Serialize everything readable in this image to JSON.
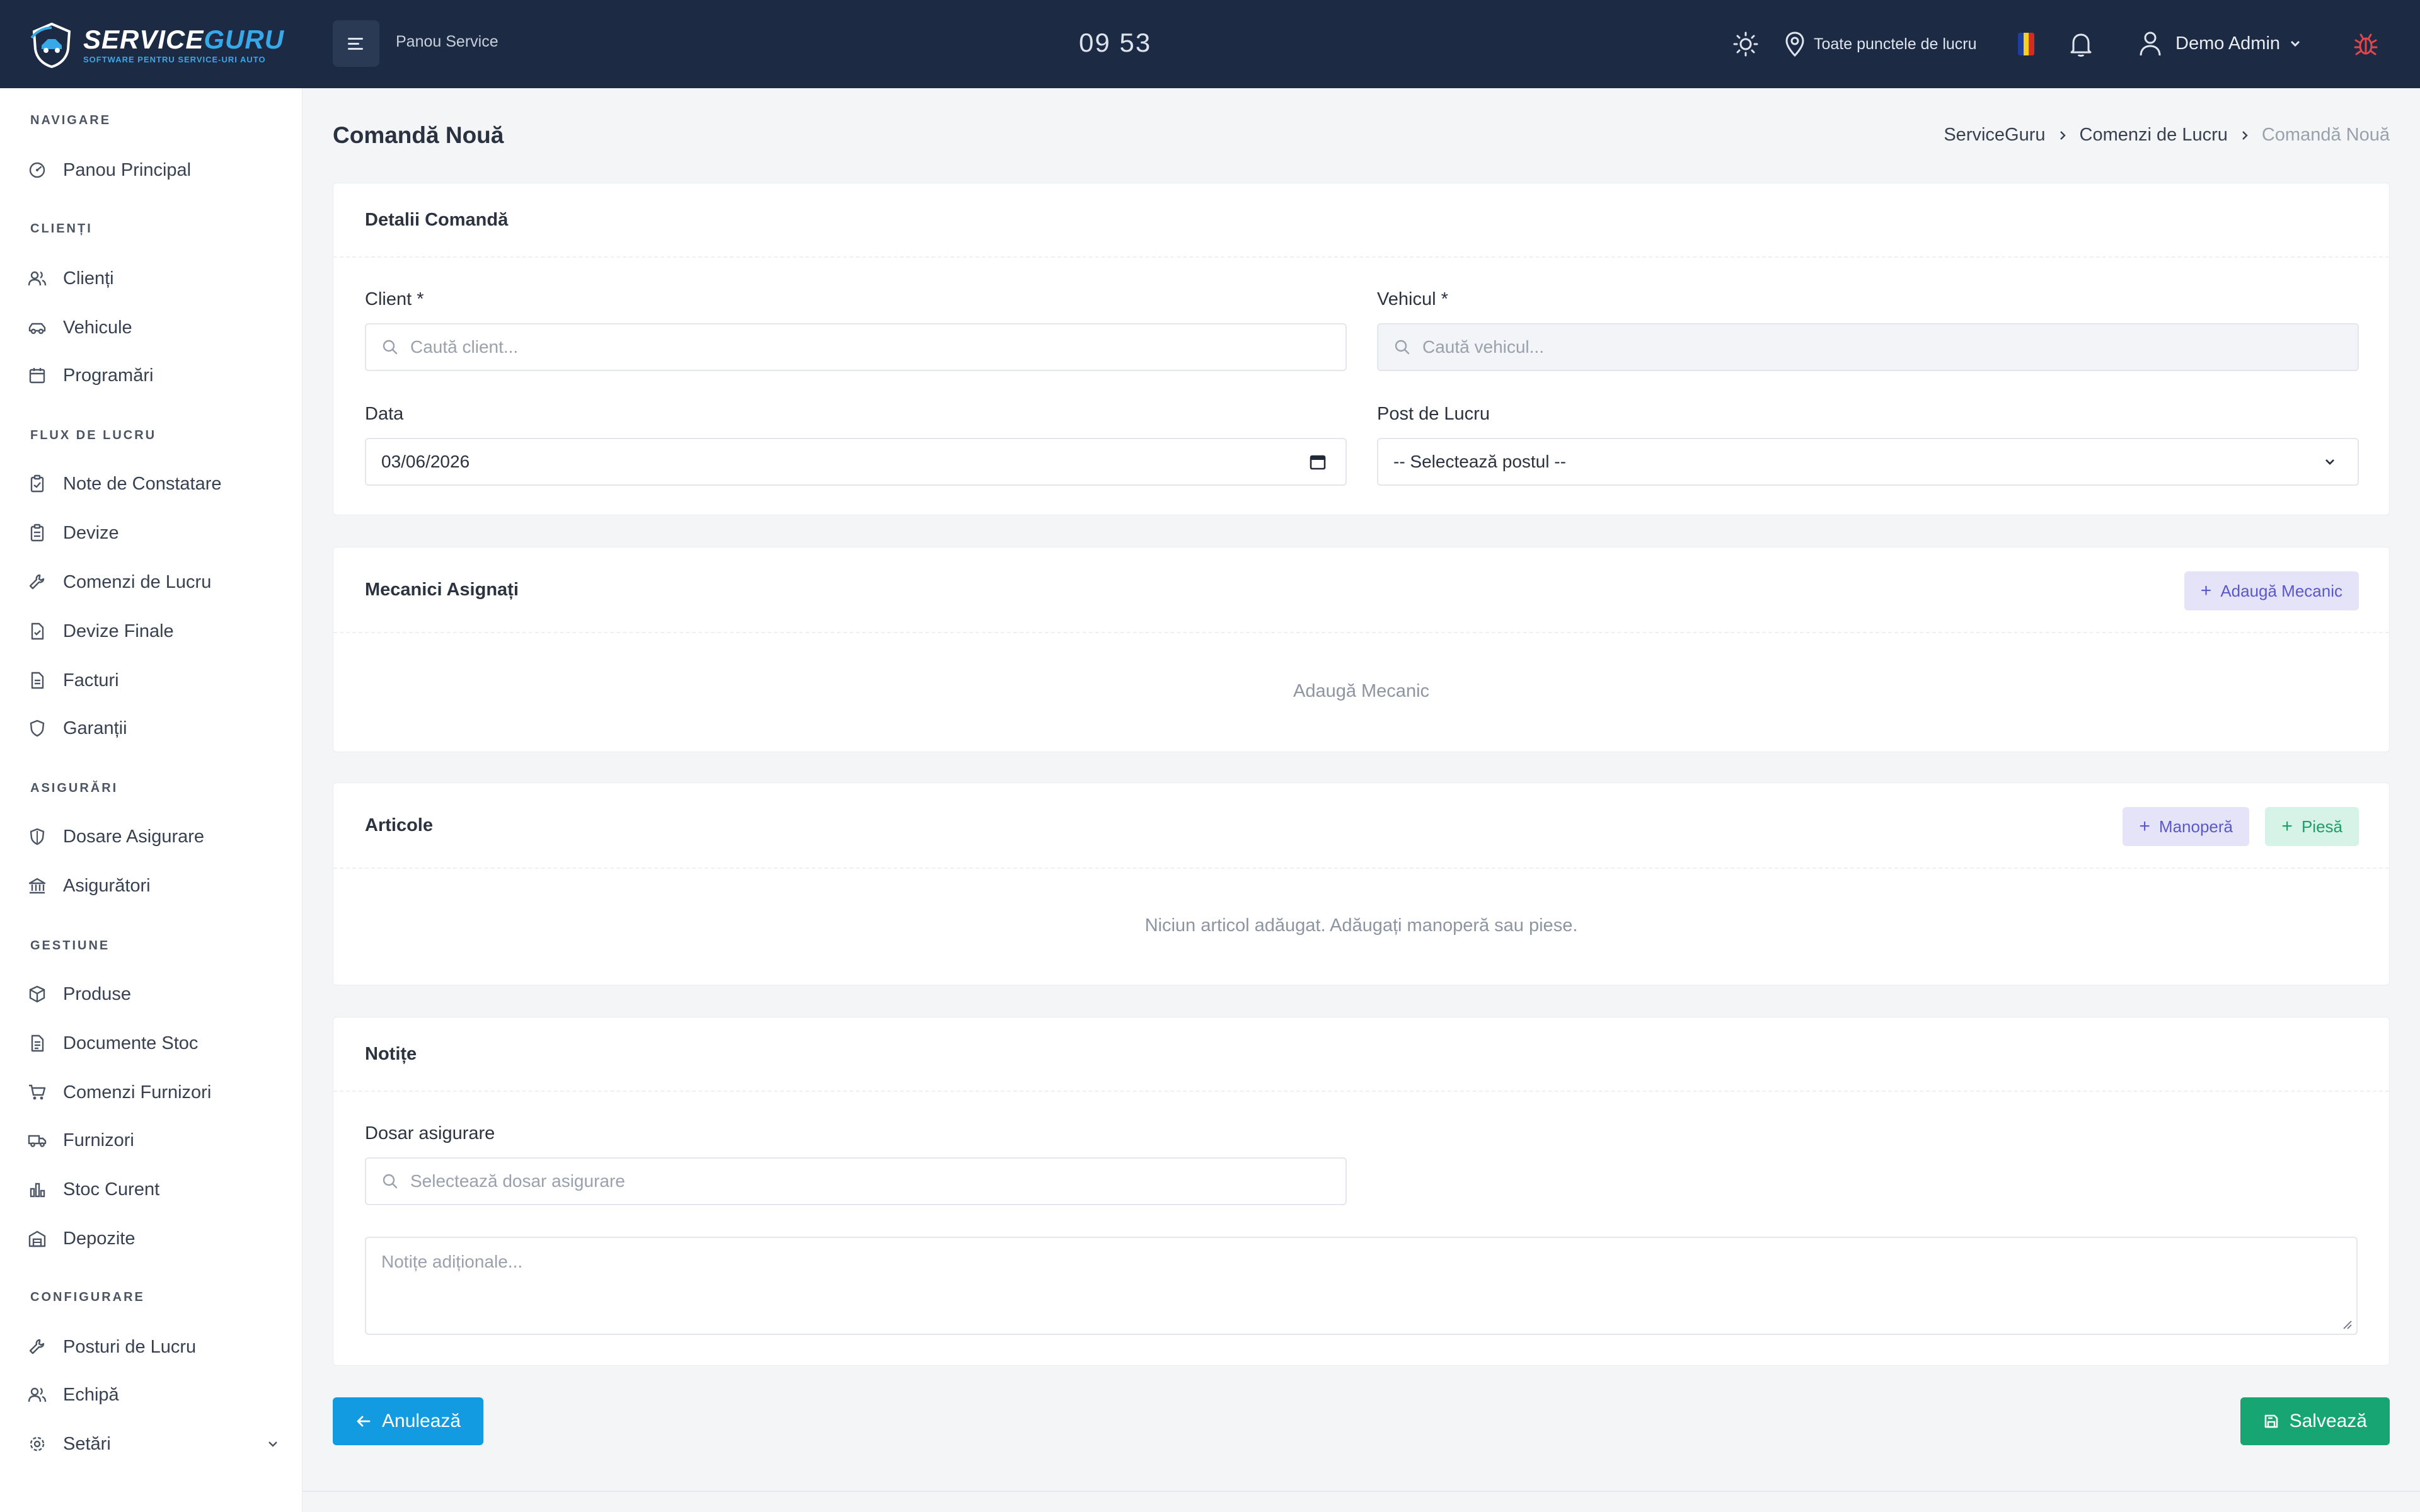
{
  "topbar": {
    "brand_white": "SERVICE",
    "brand_blue": "GURU",
    "brand_tagline": "SOFTWARE PENTRU SERVICE-URI AUTO",
    "panel_label": "Panou Service",
    "clock": "09 53",
    "location_label": "Toate punctele de lucru",
    "user_name": "Demo Admin",
    "colors": {
      "bg": "#1c2a44",
      "accent": "#38a8e8",
      "bug": "#e0474c"
    }
  },
  "sidebar": {
    "sections": [
      {
        "title": "NAVIGARE",
        "items": [
          {
            "label": "Panou Principal",
            "icon": "dashboard-icon"
          }
        ]
      },
      {
        "title": "CLIENȚI",
        "items": [
          {
            "label": "Clienți",
            "icon": "users-icon"
          },
          {
            "label": "Vehicule",
            "icon": "car-icon"
          },
          {
            "label": "Programări",
            "icon": "calendar-icon"
          }
        ]
      },
      {
        "title": "FLUX DE LUCRU",
        "items": [
          {
            "label": "Note de Constatare",
            "icon": "clipboard-icon"
          },
          {
            "label": "Devize",
            "icon": "clipboard-list-icon"
          },
          {
            "label": "Comenzi de Lucru",
            "icon": "wrench-icon"
          },
          {
            "label": "Devize Finale",
            "icon": "file-check-icon"
          },
          {
            "label": "Facturi",
            "icon": "file-text-icon"
          },
          {
            "label": "Garanții",
            "icon": "shield-check-icon"
          }
        ]
      },
      {
        "title": "ASIGURĂRI",
        "items": [
          {
            "label": "Dosare Asigurare",
            "icon": "shield-icon"
          },
          {
            "label": "Asigurători",
            "icon": "building-icon"
          }
        ]
      },
      {
        "title": "GESTIUNE",
        "items": [
          {
            "label": "Produse",
            "icon": "box-icon"
          },
          {
            "label": "Documente Stoc",
            "icon": "document-icon"
          },
          {
            "label": "Comenzi Furnizori",
            "icon": "cart-icon"
          },
          {
            "label": "Furnizori",
            "icon": "truck-icon"
          },
          {
            "label": "Stoc Curent",
            "icon": "bar-chart-icon"
          },
          {
            "label": "Depozite",
            "icon": "warehouse-icon"
          }
        ]
      },
      {
        "title": "CONFIGURARE",
        "items": [
          {
            "label": "Posturi de Lucru",
            "icon": "wrench-icon"
          },
          {
            "label": "Echipă",
            "icon": "team-icon"
          },
          {
            "label": "Setări",
            "icon": "gear-icon"
          }
        ]
      }
    ]
  },
  "page": {
    "title": "Comandă Nouă",
    "breadcrumb": [
      "ServiceGuru",
      "Comenzi de Lucru",
      "Comandă Nouă"
    ]
  },
  "order_details": {
    "title": "Detalii Comandă",
    "client_label": "Client *",
    "client_placeholder": "Caută client...",
    "vehicle_label": "Vehicul *",
    "vehicle_placeholder": "Caută vehicul...",
    "date_label": "Data",
    "date_value": "03/06/2026",
    "workstation_label": "Post de Lucru",
    "workstation_value": "-- Selectează postul --"
  },
  "mechanics": {
    "title": "Mecanici Asignați",
    "add_button": "Adaugă Mecanic",
    "empty": "Adaugă Mecanic"
  },
  "articles": {
    "title": "Articole",
    "labor_button": "Manoperă",
    "part_button": "Piesă",
    "empty": "Niciun articol adăugat. Adăugați manoperă sau piese."
  },
  "notes": {
    "title": "Notițe",
    "insurance_label": "Dosar asigurare",
    "insurance_placeholder": "Selectează dosar asigurare",
    "notes_placeholder": "Notițe adiționale..."
  },
  "actions": {
    "cancel": "Anulează",
    "save": "Salvează"
  }
}
